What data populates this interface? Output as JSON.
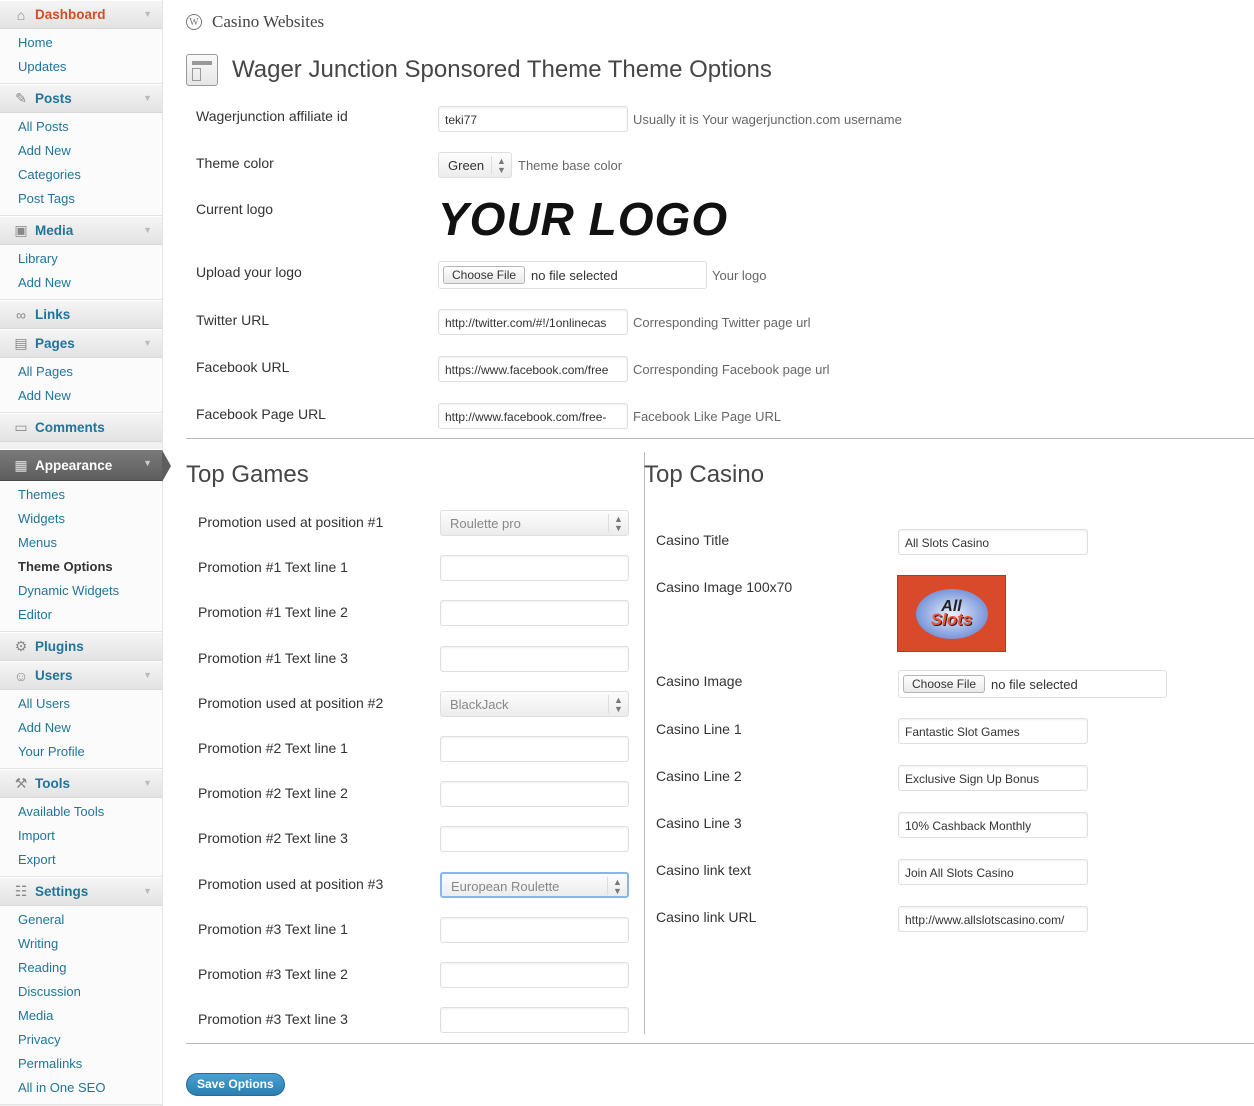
{
  "site_title": "Casino Websites",
  "page_title": "Wager Junction Sponsored Theme Theme Options",
  "sidebar": {
    "dashboard": {
      "label": "Dashboard",
      "items": [
        "Home",
        "Updates"
      ]
    },
    "posts": {
      "label": "Posts",
      "items": [
        "All Posts",
        "Add New",
        "Categories",
        "Post Tags"
      ]
    },
    "media": {
      "label": "Media",
      "items": [
        "Library",
        "Add New"
      ]
    },
    "links": {
      "label": "Links"
    },
    "pages": {
      "label": "Pages",
      "items": [
        "All Pages",
        "Add New"
      ]
    },
    "comments": {
      "label": "Comments"
    },
    "appearance": {
      "label": "Appearance",
      "items": [
        "Themes",
        "Widgets",
        "Menus",
        "Theme Options",
        "Dynamic Widgets",
        "Editor"
      ]
    },
    "plugins": {
      "label": "Plugins"
    },
    "users": {
      "label": "Users",
      "items": [
        "All Users",
        "Add New",
        "Your Profile"
      ]
    },
    "tools": {
      "label": "Tools",
      "items": [
        "Available Tools",
        "Import",
        "Export"
      ]
    },
    "settings": {
      "label": "Settings",
      "items": [
        "General",
        "Writing",
        "Reading",
        "Discussion",
        "Media",
        "Privacy",
        "Permalinks",
        "All in One SEO"
      ]
    }
  },
  "general": {
    "affiliate": {
      "label": "Wagerjunction affiliate id",
      "value": "teki77",
      "hint": "Usually it is Your wagerjunction.com username"
    },
    "theme_color": {
      "label": "Theme color",
      "value": "Green",
      "hint": "Theme base color"
    },
    "current_logo": {
      "label": "Current logo",
      "logo_text": "YOUR LOGO"
    },
    "upload_logo": {
      "label": "Upload your logo",
      "button": "Choose File",
      "status": "no file selected",
      "hint": "Your logo"
    },
    "twitter": {
      "label": "Twitter URL",
      "value": "http://twitter.com/#!/1onlinecas",
      "hint": "Corresponding Twitter page url"
    },
    "facebook": {
      "label": "Facebook URL",
      "value": "https://www.facebook.com/free",
      "hint": "Corresponding Facebook page url"
    },
    "facebook_page": {
      "label": "Facebook Page URL",
      "value": "http://www.facebook.com/free-",
      "hint": "Facebook Like Page URL"
    }
  },
  "top_games": {
    "heading": "Top Games",
    "rows": [
      {
        "label": "Promotion used at position #1",
        "type": "select",
        "value": "Roulette pro"
      },
      {
        "label": "Promotion #1 Text line 1",
        "type": "text",
        "value": ""
      },
      {
        "label": "Promotion #1 Text line 2",
        "type": "text",
        "value": ""
      },
      {
        "label": "Promotion #1 Text line 3",
        "type": "text",
        "value": ""
      },
      {
        "label": "Promotion used at position #2",
        "type": "select",
        "value": "BlackJack"
      },
      {
        "label": "Promotion #2 Text line 1",
        "type": "text",
        "value": ""
      },
      {
        "label": "Promotion #2 Text line 2",
        "type": "text",
        "value": ""
      },
      {
        "label": "Promotion #2 Text line 3",
        "type": "text",
        "value": ""
      },
      {
        "label": "Promotion used at position #3",
        "type": "select",
        "value": "European Roulette"
      },
      {
        "label": "Promotion #3 Text line 1",
        "type": "text",
        "value": ""
      },
      {
        "label": "Promotion #3 Text line 2",
        "type": "text",
        "value": ""
      },
      {
        "label": "Promotion #3 Text line 3",
        "type": "text",
        "value": ""
      }
    ]
  },
  "top_casino": {
    "heading": "Top Casino",
    "title": {
      "label": "Casino Title",
      "value": "All Slots Casino"
    },
    "image_small": {
      "label": "Casino Image 100x70",
      "badge_line1": "All",
      "badge_line2": "Slots"
    },
    "image": {
      "label": "Casino Image",
      "button": "Choose File",
      "status": "no file selected"
    },
    "line1": {
      "label": "Casino Line 1",
      "value": "Fantastic Slot Games"
    },
    "line2": {
      "label": "Casino Line 2",
      "value": "Exclusive Sign Up Bonus"
    },
    "line3": {
      "label": "Casino Line 3",
      "value": "10% Cashback Monthly"
    },
    "link_text": {
      "label": "Casino link text",
      "value": "Join All Slots Casino"
    },
    "link_url": {
      "label": "Casino link URL",
      "value": "http://www.allslotscasino.com/"
    }
  },
  "save_button": "Save Options"
}
